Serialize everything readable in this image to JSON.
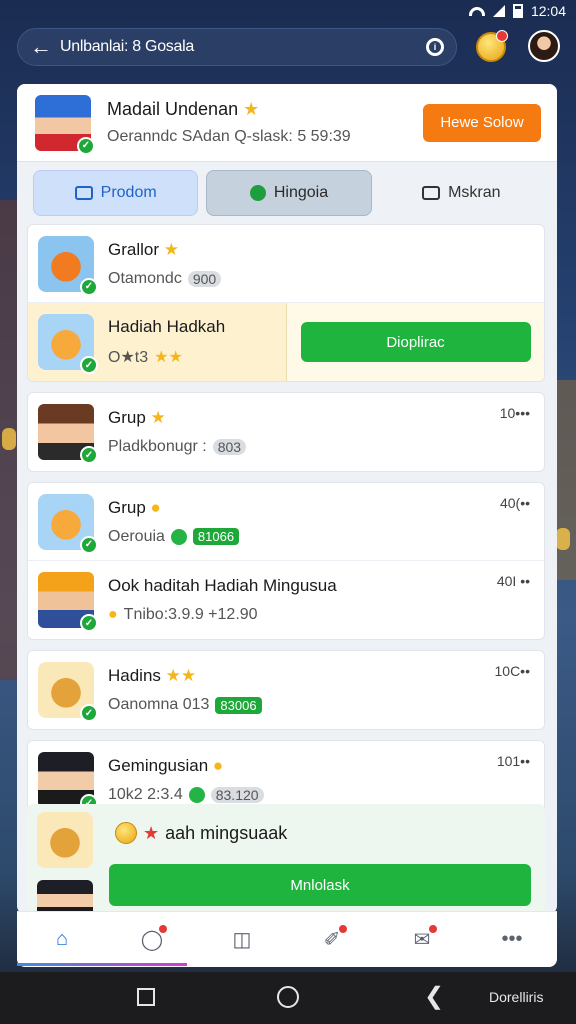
{
  "status": {
    "time": "12:04"
  },
  "topbar": {
    "title": "Unlbanlai: 8 Gosala"
  },
  "profile": {
    "name": "Madail Undenan",
    "subtitle": "Oeranndc SAdan Q-slask: 5 59:39",
    "button_label": "Hewe Solow"
  },
  "tabs": [
    {
      "label": "Prodom",
      "icon": "gift-box-icon"
    },
    {
      "label": "Hingoia",
      "icon": "chat-bubble-icon"
    },
    {
      "label": "Mskran",
      "icon": "checklist-icon"
    }
  ],
  "list": [
    {
      "title": "Grallor",
      "subtitle": "Otamondc",
      "pill": "900",
      "meta": "",
      "avatar": "gift-basket"
    },
    {
      "title": "Hadiah Hadkah",
      "subtitle": "O★t3",
      "pill": "",
      "meta": "",
      "button": "Dioplirac",
      "avatar": "gift-box"
    },
    {
      "title": "Grup",
      "subtitle": "Pladkbonugr :",
      "pill": "803",
      "meta": "10•••",
      "avatar": "woman"
    },
    {
      "title": "Grup",
      "subtitle": "Oerouia",
      "pill": "81066",
      "meta": "40(••",
      "avatar": "gift-box"
    },
    {
      "title": "Ook haditah  Hadiah Mingusua",
      "subtitle": "Tnibo:3.9.9 +12.90",
      "pill": "",
      "meta": "40I ••",
      "avatar": "man"
    },
    {
      "title": "Hadins",
      "subtitle": "Oanomna 013",
      "pill": "83006",
      "meta": "10C••",
      "avatar": "gift-basket"
    },
    {
      "title": "Gemingusian",
      "subtitle": "10k2 2:3.4",
      "pill": "83.120",
      "meta": "101••",
      "avatar": "woman-dark"
    }
  ],
  "promo": {
    "title": "aah mingsuaak",
    "button": "Mnlolask"
  },
  "tabbar": [
    "home-icon",
    "chat-icon",
    "book-icon",
    "feather-icon",
    "message-icon",
    "more-icon"
  ],
  "navbar": {
    "label": "Dorelliris"
  }
}
